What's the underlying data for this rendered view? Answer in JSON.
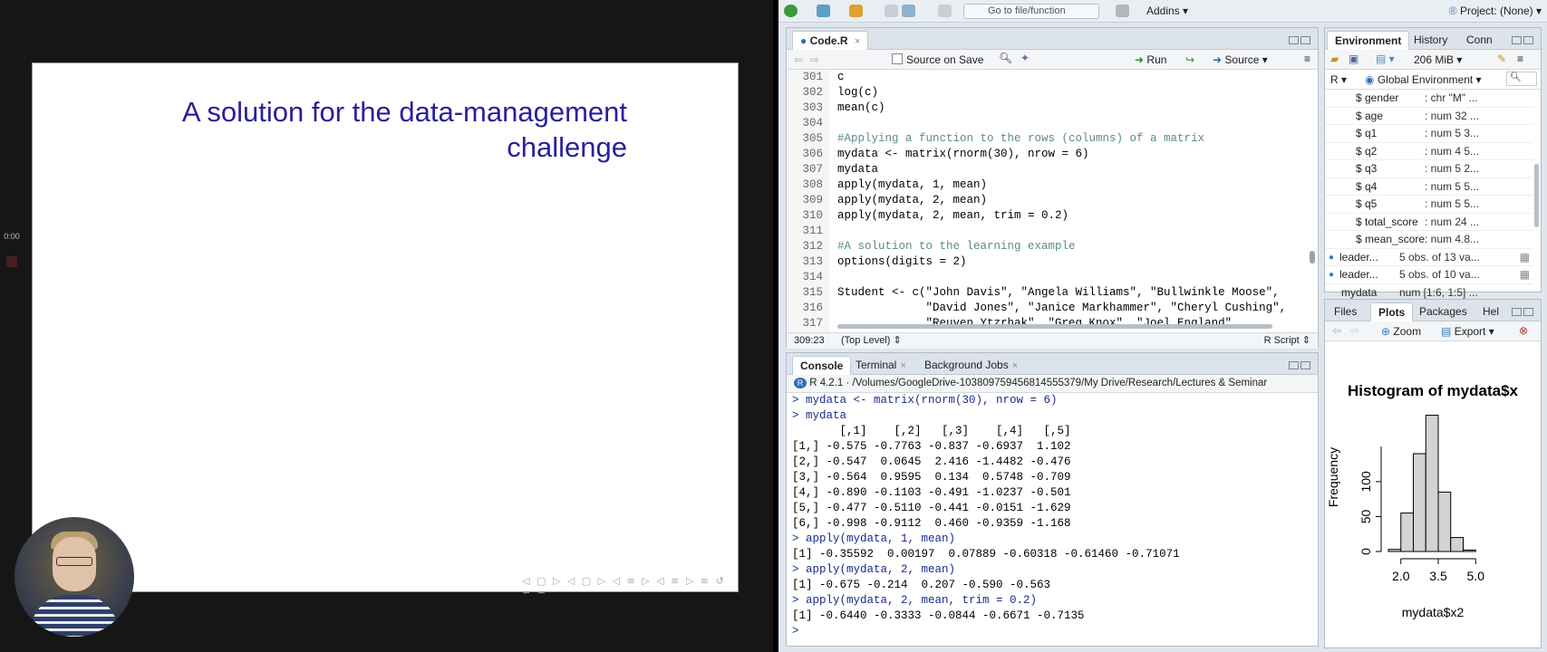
{
  "slide": {
    "title_line1": "A solution for the data-management",
    "title_line2": "challenge",
    "nav_symbols": "◁ ▢ ▷ ◁ ▢ ▷ ◁ ≡ ▷ ◁ ≡ ▷ ≡ ↺ ∽ ∽"
  },
  "recorder": {
    "time": "0:00"
  },
  "rstudio": {
    "toolbar": {
      "goto_placeholder": "Go to file/function",
      "addins_label": "Addins",
      "project_label": "Project: (None)"
    },
    "editor": {
      "tab_label": "Code.R",
      "source_on_save": "Source on Save",
      "run_label": "Run",
      "source_label": "Source",
      "line_numbers": [
        "301",
        "302",
        "303",
        "304",
        "305",
        "306",
        "307",
        "308",
        "309",
        "310",
        "311",
        "312",
        "313",
        "314",
        "315",
        "316",
        "317"
      ],
      "code_lines": [
        "c",
        "log(c)",
        "mean(c)",
        "",
        "#Applying a function to the rows (columns) of a matrix",
        "mydata <- matrix(rnorm(30), nrow = 6)",
        "mydata",
        "apply(mydata, 1, mean)",
        "apply(mydata, 2, mean)",
        "apply(mydata, 2, mean, trim = 0.2)",
        "",
        "#A solution to the learning example",
        "options(digits = 2)",
        "",
        "Student <- c(\"John Davis\", \"Angela Williams\", \"Bullwinkle Moose\",",
        "             \"David Jones\", \"Janice Markhammer\", \"Cheryl Cushing\",",
        "             \"Reuven Ytzrhak\", \"Greg Knox\", \"Joel England\","
      ],
      "status_position": "309:23",
      "status_scope": "(Top Level)",
      "status_type": "R Script"
    },
    "console": {
      "tabs": [
        "Console",
        "Terminal",
        "Background Jobs"
      ],
      "r_version": "R 4.2.1",
      "path": "/Volumes/GoogleDrive-103809759456814555379/My Drive/Research/Lectures & Seminar",
      "lines": [
        {
          "text": "> mydata <- matrix(rnorm(30), nrow = 6)",
          "cmd": true
        },
        {
          "text": "> mydata",
          "cmd": true
        },
        {
          "text": "       [,1]    [,2]   [,3]    [,4]   [,5]",
          "cmd": false
        },
        {
          "text": "[1,] -0.575 -0.7763 -0.837 -0.6937  1.102",
          "cmd": false
        },
        {
          "text": "[2,] -0.547  0.0645  2.416 -1.4482 -0.476",
          "cmd": false
        },
        {
          "text": "[3,] -0.564  0.9595  0.134  0.5748 -0.709",
          "cmd": false
        },
        {
          "text": "[4,] -0.890 -0.1103 -0.491 -1.0237 -0.501",
          "cmd": false
        },
        {
          "text": "[5,] -0.477 -0.5110 -0.441 -0.0151 -1.629",
          "cmd": false
        },
        {
          "text": "[6,] -0.998 -0.9112  0.460 -0.9359 -1.168",
          "cmd": false
        },
        {
          "text": "> apply(mydata, 1, mean)",
          "cmd": true
        },
        {
          "text": "[1] -0.35592  0.00197  0.07889 -0.60318 -0.61460 -0.71071",
          "cmd": false
        },
        {
          "text": "> apply(mydata, 2, mean)",
          "cmd": true
        },
        {
          "text": "[1] -0.675 -0.214  0.207 -0.590 -0.563",
          "cmd": false
        },
        {
          "text": "> apply(mydata, 2, mean, trim = 0.2)",
          "cmd": true
        },
        {
          "text": "[1] -0.6440 -0.3333 -0.0844 -0.6671 -0.7135",
          "cmd": false
        },
        {
          "text": "> ",
          "cmd": true
        }
      ]
    },
    "environment": {
      "tabs": [
        "Environment",
        "History",
        "Conn"
      ],
      "memory": "206 MiB",
      "lang": "R",
      "scope": "Global Environment",
      "rows": [
        {
          "name": "$ gender",
          "value": ": chr \"M\" ..."
        },
        {
          "name": "$ age",
          "value": ": num  32 ..."
        },
        {
          "name": "$ q1",
          "value": ": num  5 3..."
        },
        {
          "name": "$ q2",
          "value": ": num  4 5..."
        },
        {
          "name": "$ q3",
          "value": ": num  5 2..."
        },
        {
          "name": "$ q4",
          "value": ": num  5 5..."
        },
        {
          "name": "$ q5",
          "value": ": num  5 5..."
        },
        {
          "name": "$ total_score",
          "value": ": num  24 ..."
        },
        {
          "name": "$ mean_score",
          "value": ": num  4.8..."
        },
        {
          "name": "leader...",
          "value": "5 obs. of 13 va..."
        },
        {
          "name": "leader...",
          "value": "5 obs. of 10 va..."
        },
        {
          "name": "mydata",
          "value": "num [1:6, 1:5] ..."
        }
      ]
    },
    "plots": {
      "tabs": [
        "Files",
        "Plots",
        "Packages",
        "Hel"
      ],
      "zoom_label": "Zoom",
      "export_label": "Export"
    }
  },
  "chart_data": {
    "type": "bar",
    "title": "Histogram of mydata$x",
    "xlabel": "mydata$x2",
    "ylabel": "Frequency",
    "bin_edges": [
      1.5,
      2.0,
      2.5,
      3.0,
      3.5,
      4.0,
      4.5,
      5.0,
      5.5
    ],
    "values": [
      3,
      55,
      140,
      195,
      85,
      20,
      2,
      0
    ],
    "x_ticks": [
      "2.0",
      "3.5",
      "5.0"
    ],
    "y_ticks": [
      "0",
      "50",
      "100"
    ],
    "xlim": [
      1.5,
      5.5
    ],
    "ylim": [
      0,
      210
    ]
  }
}
